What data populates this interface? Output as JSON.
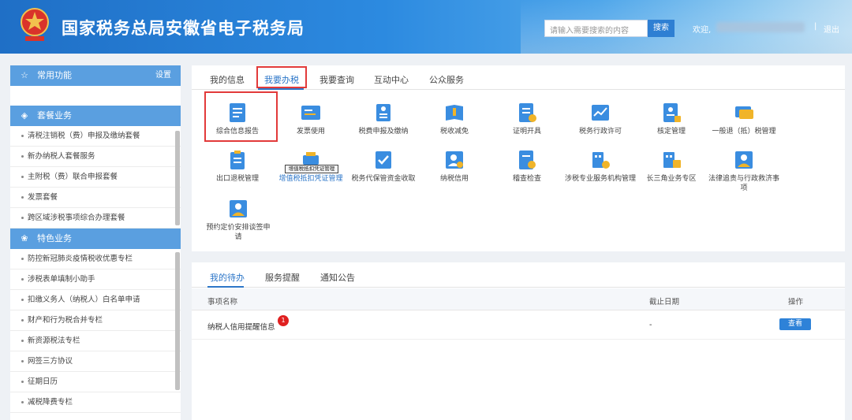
{
  "header": {
    "site_title": "国家税务总局安徽省电子税务局",
    "search_placeholder": "请输入需要搜索的内容",
    "search_button": "搜索",
    "welcome": "欢迎,",
    "separator": "|",
    "logout": "退出",
    "emblem_caption": "中国税务"
  },
  "sidebar": {
    "common": {
      "title": "常用功能",
      "settings": "设置"
    },
    "package": {
      "title": "套餐业务",
      "items": [
        "清税注销税（费）申报及缴纳套餐",
        "新办纳税人套餐服务",
        "主附税（费）联合申报套餐",
        "发票套餐",
        "跨区域涉税事项综合办理套餐"
      ]
    },
    "special": {
      "title": "特色业务",
      "items": [
        "防控新冠肺炎疫情税收优惠专栏",
        "涉税表单填制小助手",
        "扣缴义务人（纳税人）白名单申请",
        "财产和行为税合并专栏",
        "新资源税法专栏",
        "网签三方协议",
        "征期日历",
        "减税降费专栏"
      ]
    }
  },
  "main": {
    "tabs": [
      "我的信息",
      "我要办税",
      "我要查询",
      "互动中心",
      "公众服务"
    ],
    "active_tab": "我要办税",
    "services": [
      "综合信息报告",
      "发票使用",
      "税费申报及缴纳",
      "税收减免",
      "证明开具",
      "税务行政许可",
      "核定管理",
      "一般退（抵）税管理",
      "出口退税管理",
      "增值税抵扣凭证管理",
      "税务代保管资金收取",
      "纳税信用",
      "稽查检查",
      "涉税专业服务机构管理",
      "长三角业务专区",
      "法律追责与行政救济事项",
      "预约定价安排谈签申请"
    ],
    "tooltip": "增值税抵扣凭证管理"
  },
  "todo": {
    "tabs": [
      "我的待办",
      "服务提醒",
      "通知公告"
    ],
    "active_tab": "我的待办",
    "columns": {
      "name": "事项名称",
      "deadline": "截止日期",
      "action": "操作"
    },
    "rows": [
      {
        "name": "纳税人信用提醒信息",
        "badge": "1",
        "deadline": "-",
        "action": "查看"
      }
    ]
  },
  "colors": {
    "accent": "#2c76c8",
    "sidebar_header": "#5a9fe0",
    "highlight": "#e23a3a",
    "badge": "#e02020"
  }
}
